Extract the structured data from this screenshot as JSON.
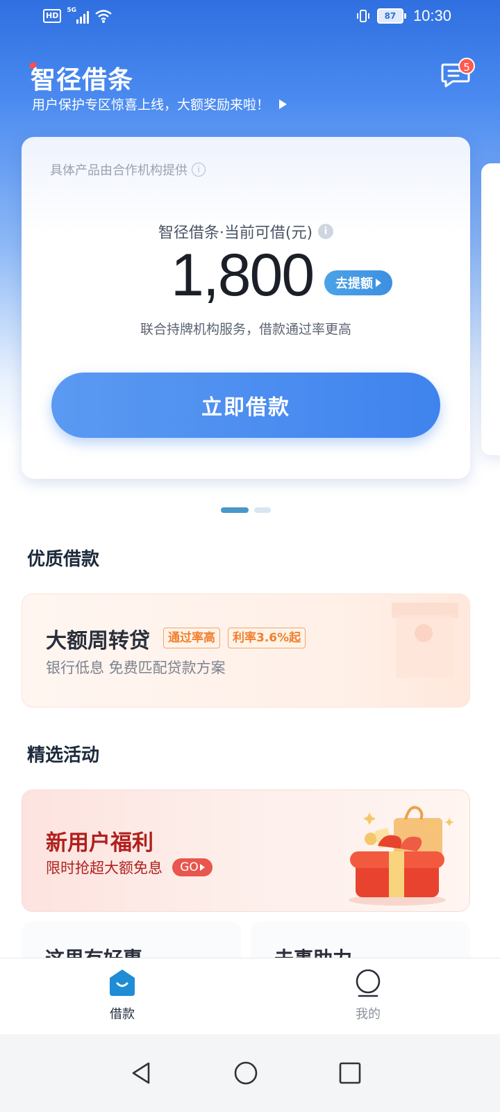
{
  "status_bar": {
    "hd": "HD",
    "network": "5G",
    "battery": "87",
    "time": "10:30"
  },
  "header": {
    "title": "智径借条",
    "subtitle": "用户保护专区惊喜上线，大额奖励来啦！",
    "message_badge": "5"
  },
  "limit_card": {
    "provider_note": "具体产品由合作机构提供",
    "label": "智径借条·当前可借(元)",
    "amount": "1,800",
    "raise_button": "去提额",
    "service_note": "联合持牌机构服务，借款通过率更高",
    "borrow_button": "立即借款"
  },
  "carousel": {
    "pages": 2,
    "active": 1
  },
  "sections": {
    "quality_loans": "优质借款",
    "activities": "精选活动"
  },
  "loan_card": {
    "title": "大额周转贷",
    "tags": [
      "通过率高",
      "利率3.6%起"
    ],
    "desc": "银行低息 免费匹配贷款方案"
  },
  "activity_card": {
    "title": "新用户福利",
    "subtitle": "限时抢超大额免息",
    "go": "GO"
  },
  "mini_cards": [
    "这里有好惠",
    "去事助力"
  ],
  "tabbar": {
    "items": [
      {
        "label": "借款",
        "icon": "home-icon",
        "active": true
      },
      {
        "label": "我的",
        "icon": "user-icon",
        "active": false
      }
    ]
  },
  "colors": {
    "primary_blue": "#3f83ee",
    "active_tab": "#1f8dd6",
    "inactive_tab": "#8a919c",
    "badge_red": "#ff5a4f",
    "activity_red": "#b0201d",
    "tag_orange": "#f07f2e"
  }
}
